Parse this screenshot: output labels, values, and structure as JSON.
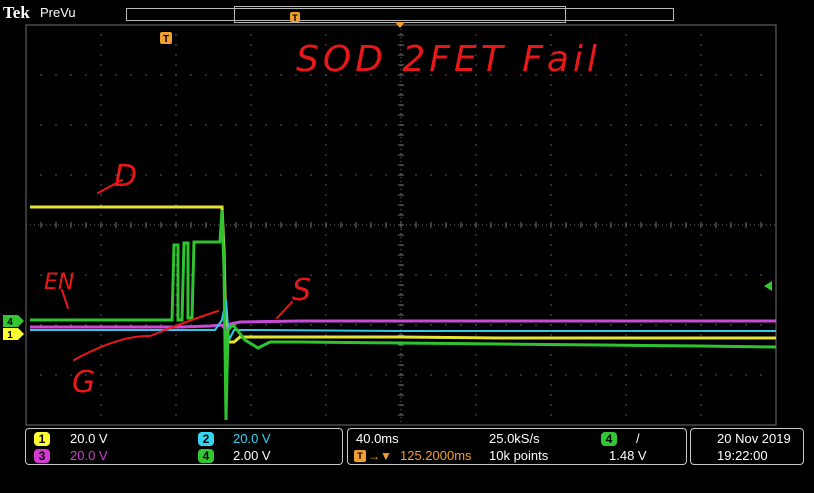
{
  "header": {
    "brand": "Tek",
    "mode": "PreVu",
    "trigger_marker": "T"
  },
  "annotations": {
    "title": "SOD 2FET Fail",
    "d": "D",
    "en": "EN",
    "s": "S",
    "g": "G"
  },
  "channels": [
    {
      "id": "1",
      "scale": "20.0 V",
      "color": "#ffff33"
    },
    {
      "id": "2",
      "scale": "20.0 V",
      "color": "#33d6f2"
    },
    {
      "id": "3",
      "scale": "20.0 V",
      "color": "#d43ad4"
    },
    {
      "id": "4",
      "scale": "2.00 V",
      "color": "#33c733"
    }
  ],
  "ground_markers": [
    "4",
    "1"
  ],
  "timebase": {
    "scale": "40.0ms",
    "sample_rate": "25.0kS/s",
    "trigger_position": "125.2000ms",
    "record_length": "10k points"
  },
  "trigger": {
    "source": "4",
    "slope": "/",
    "level": "1.48 V"
  },
  "timestamp": {
    "date": "20 Nov 2019",
    "time": "19:22:00"
  },
  "colors": {
    "annotation": "#e81818",
    "grid": "#707070",
    "trigger": "#f0a030",
    "background": "#000000"
  }
}
